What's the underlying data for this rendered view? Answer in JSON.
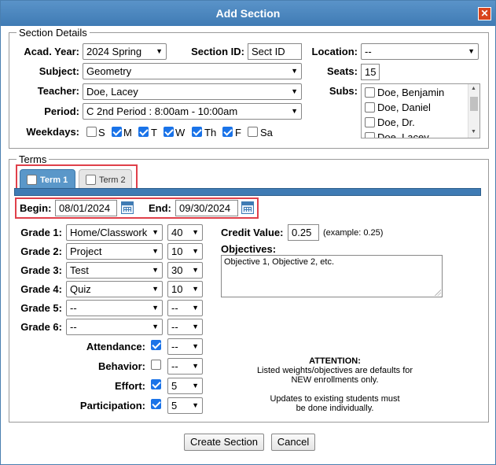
{
  "dialog": {
    "title": "Add Section",
    "close": "✕"
  },
  "section_details": {
    "legend": "Section Details",
    "acad_year": {
      "label": "Acad. Year:",
      "value": "2024 Spring"
    },
    "section_id": {
      "label": "Section ID:",
      "value": "Sect ID"
    },
    "location": {
      "label": "Location:",
      "value": "--"
    },
    "subject": {
      "label": "Subject:",
      "value": "Geometry"
    },
    "seats": {
      "label": "Seats:",
      "value": "15"
    },
    "teacher": {
      "label": "Teacher:",
      "value": "Doe, Lacey"
    },
    "subs": {
      "label": "Subs:",
      "items": [
        "Doe, Benjamin",
        "Doe, Daniel",
        "Doe, Dr.",
        "Doe, Lacey"
      ]
    },
    "period": {
      "label": "Period:",
      "value": "C 2nd Period : 8:00am - 10:00am"
    },
    "weekdays": {
      "label": "Weekdays:",
      "days": [
        {
          "label": "S",
          "checked": false
        },
        {
          "label": "M",
          "checked": true
        },
        {
          "label": "T",
          "checked": true
        },
        {
          "label": "W",
          "checked": true
        },
        {
          "label": "Th",
          "checked": true
        },
        {
          "label": "F",
          "checked": true
        },
        {
          "label": "Sa",
          "checked": false
        }
      ]
    }
  },
  "terms": {
    "legend": "Terms",
    "tabs": [
      {
        "label": "Term 1",
        "active": true
      },
      {
        "label": "Term 2",
        "active": false
      }
    ],
    "begin": {
      "label": "Begin:",
      "value": "08/01/2024"
    },
    "end": {
      "label": "End:",
      "value": "09/30/2024"
    },
    "grades": [
      {
        "label": "Grade 1:",
        "type": "Home/Classwork",
        "weight": "40"
      },
      {
        "label": "Grade 2:",
        "type": "Project",
        "weight": "10"
      },
      {
        "label": "Grade 3:",
        "type": "Test",
        "weight": "30"
      },
      {
        "label": "Grade 4:",
        "type": "Quiz",
        "weight": "10"
      },
      {
        "label": "Grade 5:",
        "type": "--",
        "weight": "--"
      },
      {
        "label": "Grade 6:",
        "type": "--",
        "weight": "--"
      }
    ],
    "behaviors": [
      {
        "label": "Attendance:",
        "checked": true,
        "value": "--"
      },
      {
        "label": "Behavior:",
        "checked": false,
        "value": "--"
      },
      {
        "label": "Effort:",
        "checked": true,
        "value": "5"
      },
      {
        "label": "Participation:",
        "checked": true,
        "value": "5"
      }
    ],
    "credit_value": {
      "label": "Credit Value:",
      "value": "0.25",
      "example": "(example: 0.25)"
    },
    "objectives": {
      "label": "Objectives:",
      "placeholder": "Objective 1, Objective 2, etc."
    },
    "attention": {
      "title": "ATTENTION:",
      "line1": "Listed weights/objectives are defaults for",
      "line2": "NEW enrollments only.",
      "line3": "Updates to existing students must",
      "line4": "be done individually."
    }
  },
  "buttons": {
    "create": "Create Section",
    "cancel": "Cancel"
  },
  "colors": {
    "titlebar": "#3f7bb4",
    "highlight": "#e0404a",
    "check": "#1a73e8"
  }
}
